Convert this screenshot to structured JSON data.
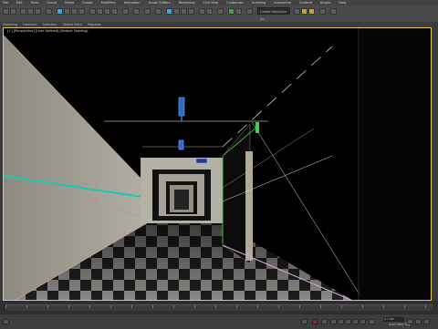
{
  "menu": {
    "items": [
      "File",
      "Edit",
      "Tools",
      "Group",
      "Views",
      "Create",
      "Modifiers",
      "Animation",
      "Graph Editors",
      "Rendering",
      "Civil View",
      "Customize",
      "Scripting",
      "Interactive",
      "Content",
      "Arnold",
      "Help"
    ]
  },
  "toolbar": {
    "selection_set_placeholder": "Create Selection Se"
  },
  "ribbon": {
    "tabs": [
      "Modeling",
      "Freeform",
      "Selection",
      "Object Paint",
      "Populate"
    ]
  },
  "viewport": {
    "label": "[+] [Perspective] [User Defined] [Default Shading]",
    "accent_color": "#e8c84a"
  },
  "timeline": {
    "frame_value": "0 / 100"
  },
  "statusbar": {
    "add_time_tag": "Add Time Tag"
  }
}
